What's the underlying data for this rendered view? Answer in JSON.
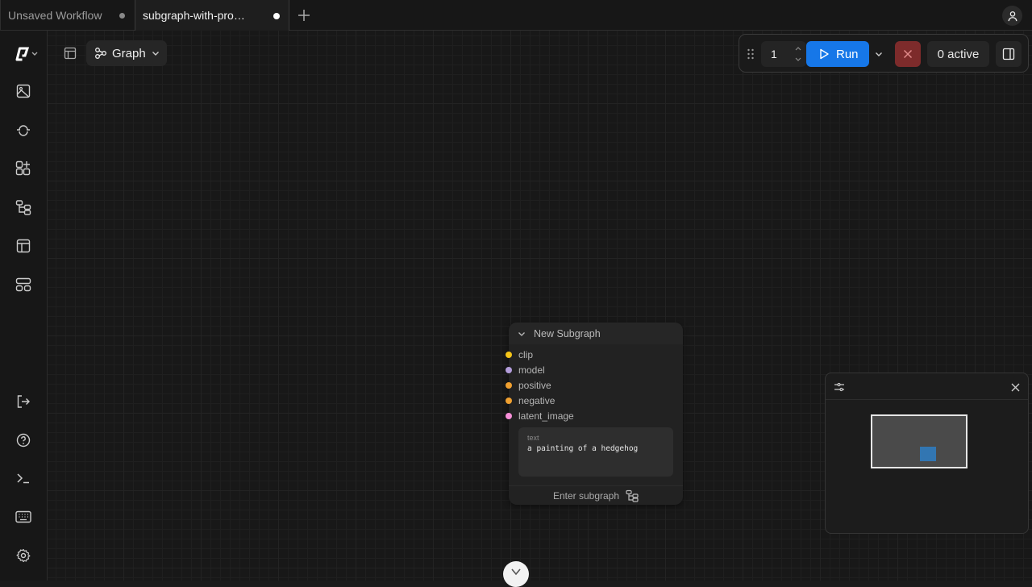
{
  "tabs": [
    {
      "label": "Unsaved Workflow",
      "modified": true
    },
    {
      "label": "subgraph-with-pro…",
      "modified": true,
      "active": true
    }
  ],
  "canvas_toolbar": {
    "view_mode": "Graph"
  },
  "run_toolbar": {
    "batch_count": "1",
    "run_label": "Run",
    "queue_status": "0 active"
  },
  "node": {
    "title": "New Subgraph",
    "inputs": [
      {
        "label": "clip",
        "color": "#f5c518"
      },
      {
        "label": "model",
        "color": "#b39ddb"
      },
      {
        "label": "positive",
        "color": "#f0a030"
      },
      {
        "label": "negative",
        "color": "#f0a030"
      },
      {
        "label": "latent_image",
        "color": "#f78fd8"
      }
    ],
    "text_widget": {
      "label": "text",
      "value": "a painting of a hedgehog"
    },
    "enter_label": "Enter subgraph"
  },
  "sidebar": {
    "items": [
      {
        "name": "logo-menu",
        "icon": "comfy-logo"
      },
      {
        "name": "assets",
        "icon": "image-icon"
      },
      {
        "name": "queue",
        "icon": "queue-icon"
      },
      {
        "name": "node-library",
        "icon": "node-library-icon"
      },
      {
        "name": "workflows",
        "icon": "workflow-icon"
      },
      {
        "name": "templates",
        "icon": "template-icon"
      },
      {
        "name": "model-library",
        "icon": "model-library-icon"
      }
    ],
    "bottom_items": [
      {
        "name": "logout",
        "icon": "logout-icon"
      },
      {
        "name": "help",
        "icon": "help-icon"
      },
      {
        "name": "console",
        "icon": "terminal-icon"
      },
      {
        "name": "keybindings",
        "icon": "keyboard-icon"
      },
      {
        "name": "settings",
        "icon": "gear-icon"
      }
    ]
  },
  "colors": {
    "accent": "#1677e8",
    "stop": "#7d2b2b",
    "minimap_node": "#3276b2"
  }
}
